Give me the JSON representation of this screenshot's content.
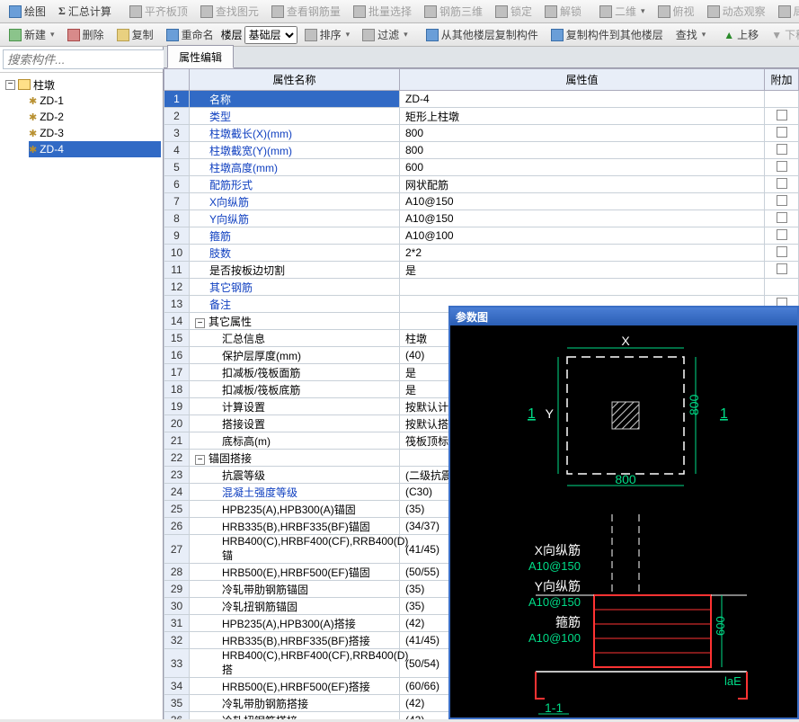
{
  "toolbar_top": {
    "draw": "绘图",
    "summary": "汇总计算",
    "align_top": "平齐板顶",
    "find_element": "查找图元",
    "check_rebar": "查看钢筋量",
    "batch_select": "批量选择",
    "rebar3d": "钢筋三维",
    "lock": "锁定",
    "unlock": "解锁",
    "view2d": "二维",
    "overview": "俯视",
    "observe": "动态观察",
    "partial3d": "局部三"
  },
  "toolbar2": {
    "new": "新建",
    "delete": "删除",
    "copy": "复制",
    "rename": "重命名",
    "floor": "楼层",
    "floor_value": "基础层",
    "sort": "排序",
    "filter": "过滤",
    "copy_from": "从其他楼层复制构件",
    "copy_to": "复制构件到其他楼层",
    "find": "查找",
    "move_up": "上移",
    "move_down": "下移"
  },
  "sidebar": {
    "search_placeholder": "搜索构件...",
    "root": "柱墩",
    "items": [
      "ZD-1",
      "ZD-2",
      "ZD-3",
      "ZD-4"
    ],
    "selected": 3
  },
  "tab": {
    "label": "属性编辑"
  },
  "prop_header": {
    "name": "属性名称",
    "value": "属性值",
    "extra": "附加"
  },
  "rows": [
    {
      "n": "名称",
      "v": "ZD-4",
      "sel": true,
      "blue": true,
      "chk": false
    },
    {
      "n": "类型",
      "v": "矩形上柱墩",
      "blue": true,
      "chk": true
    },
    {
      "n": "柱墩截长(X)(mm)",
      "v": "800",
      "blue": true,
      "chk": true
    },
    {
      "n": "柱墩截宽(Y)(mm)",
      "v": "800",
      "blue": true,
      "chk": true
    },
    {
      "n": "柱墩高度(mm)",
      "v": "600",
      "blue": true,
      "chk": true
    },
    {
      "n": "配筋形式",
      "v": "网状配筋",
      "blue": true,
      "chk": true
    },
    {
      "n": "X向纵筋",
      "v": "A10@150",
      "blue": true,
      "chk": true
    },
    {
      "n": "Y向纵筋",
      "v": "A10@150",
      "blue": true,
      "chk": true
    },
    {
      "n": "箍筋",
      "v": "A10@100",
      "blue": true,
      "chk": true
    },
    {
      "n": "肢数",
      "v": "2*2",
      "blue": true,
      "chk": true
    },
    {
      "n": "是否按板边切割",
      "v": "是",
      "chk": true
    },
    {
      "n": "其它钢筋",
      "v": "",
      "blue": true,
      "chk": false
    },
    {
      "n": "备注",
      "v": "",
      "blue": true,
      "chk": true
    },
    {
      "n": "其它属性",
      "v": "",
      "grp": true
    },
    {
      "n": "汇总信息",
      "v": "柱墩",
      "ind": 2,
      "chk": true
    },
    {
      "n": "保护层厚度(mm)",
      "v": "(40)",
      "ind": 2,
      "chk": true
    },
    {
      "n": "扣减板/筏板面筋",
      "v": "是",
      "ind": 2,
      "chk": true
    },
    {
      "n": "扣减板/筏板底筋",
      "v": "是",
      "ind": 2,
      "chk": true
    },
    {
      "n": "计算设置",
      "v": "按默认计算",
      "ind": 2,
      "chk": false
    },
    {
      "n": "搭接设置",
      "v": "按默认搭接",
      "ind": 2,
      "chk": false
    },
    {
      "n": "底标高(m)",
      "v": "筏板顶标高",
      "ind": 2,
      "chk": true
    },
    {
      "n": "锚固搭接",
      "v": "",
      "grp": true
    },
    {
      "n": "抗震等级",
      "v": "(二级抗震",
      "ind": 2,
      "chk": true
    },
    {
      "n": "混凝土强度等级",
      "v": "(C30)",
      "ind": 2,
      "blue": true,
      "chk": true
    },
    {
      "n": "HPB235(A),HPB300(A)锚固",
      "v": "(35)",
      "ind": 2,
      "chk": true
    },
    {
      "n": "HRB335(B),HRBF335(BF)锚固",
      "v": "(34/37)",
      "ind": 2,
      "chk": true
    },
    {
      "n": "HRB400(C),HRBF400(CF),RRB400(D)锚",
      "v": "(41/45)",
      "ind": 2,
      "chk": true
    },
    {
      "n": "HRB500(E),HRBF500(EF)锚固",
      "v": "(50/55)",
      "ind": 2,
      "chk": true
    },
    {
      "n": "冷轧带肋钢筋锚固",
      "v": "(35)",
      "ind": 2,
      "chk": true
    },
    {
      "n": "冷轧扭钢筋锚固",
      "v": "(35)",
      "ind": 2,
      "chk": true
    },
    {
      "n": "HPB235(A),HPB300(A)搭接",
      "v": "(42)",
      "ind": 2,
      "chk": true
    },
    {
      "n": "HRB335(B),HRBF335(BF)搭接",
      "v": "(41/45)",
      "ind": 2,
      "chk": true
    },
    {
      "n": "HRB400(C),HRBF400(CF),RRB400(D)搭",
      "v": "(50/54)",
      "ind": 2,
      "chk": true
    },
    {
      "n": "HRB500(E),HRBF500(EF)搭接",
      "v": "(60/66)",
      "ind": 2,
      "chk": true
    },
    {
      "n": "冷轧带肋钢筋搭接",
      "v": "(42)",
      "ind": 2,
      "chk": true
    },
    {
      "n": "冷轧扭钢筋搭接",
      "v": "(42)",
      "ind": 2,
      "chk": true
    }
  ],
  "param_panel": {
    "title": "参数图",
    "dim_x": "X",
    "dim_y": "Y",
    "dim_w": "800",
    "dim_h": "800",
    "sec_label_1": "1",
    "sec_label_1b": "1",
    "sec_h": "600",
    "lx_label": "X向纵筋",
    "lx_val": "A10@150",
    "ly_label": "Y向纵筋",
    "ly_val": "A10@150",
    "stirrup_label": "箍筋",
    "stirrup_val": "A10@100",
    "lae": "laE",
    "sec_tag": "1-1"
  }
}
